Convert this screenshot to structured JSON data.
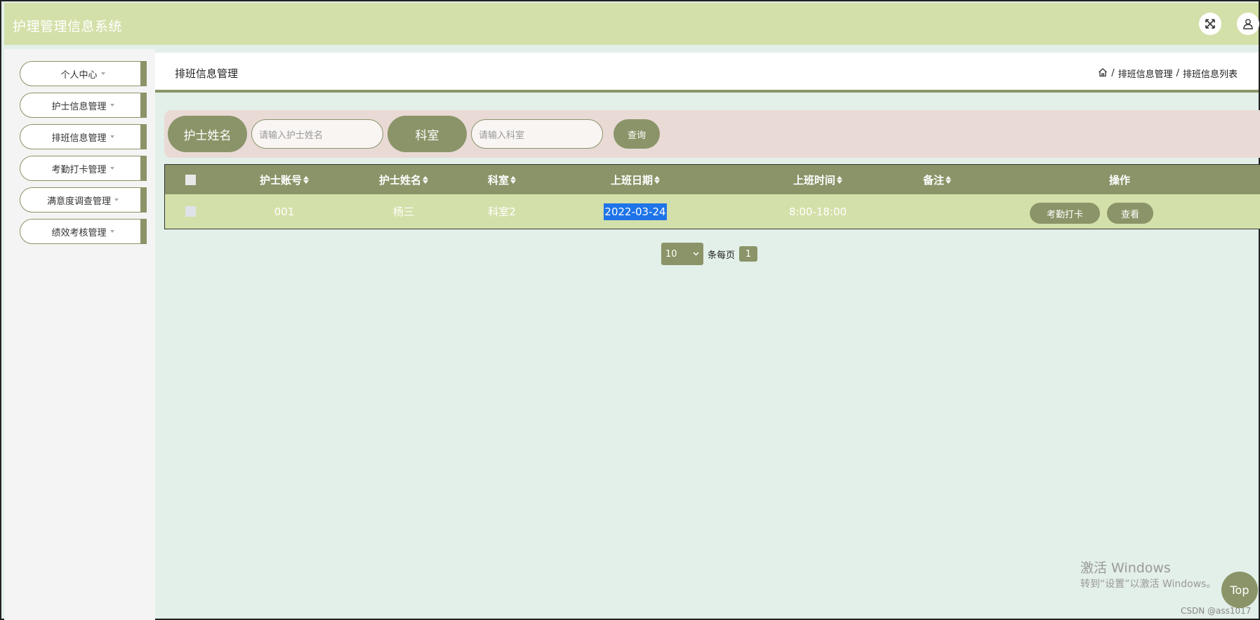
{
  "app": {
    "title": "护理管理信息系统"
  },
  "icons": {
    "expand": "expand-icon",
    "user": "user-icon",
    "home": "home-icon"
  },
  "sidebar": {
    "items": [
      {
        "label": "个人中心"
      },
      {
        "label": "护士信息管理"
      },
      {
        "label": "排班信息管理"
      },
      {
        "label": "考勤打卡管理"
      },
      {
        "label": "满意度调查管理"
      },
      {
        "label": "绩效考核管理"
      }
    ]
  },
  "header": {
    "title": "排班信息管理",
    "breadcrumb": [
      "排班信息管理",
      "排班信息列表"
    ],
    "separator": "/"
  },
  "search": {
    "label1": "护士姓名",
    "placeholder1": "请输入护士姓名",
    "label2": "科室",
    "placeholder2": "请输入科室",
    "button": "查询"
  },
  "table": {
    "columns": [
      "护士账号",
      "护士姓名",
      "科室",
      "上班日期",
      "上班时间",
      "备注",
      "操作"
    ],
    "rows": [
      {
        "account": "001",
        "name": "杨三",
        "dept": "科室2",
        "date": "2022-03-24",
        "time": "8:00-18:00",
        "note": "",
        "actions": [
          "考勤打卡",
          "查看"
        ]
      }
    ]
  },
  "pagination": {
    "page_size": "10",
    "per_page_label": "条每页",
    "current_page": "1"
  },
  "watermark": {
    "line1": "激活 Windows",
    "line2": "转到“设置”以激活 Windows。",
    "credit": "CSDN @ass1017"
  },
  "back_to_top": "Top",
  "colors": {
    "topbar": "#d3e0a9",
    "accent": "#8a9468",
    "background": "#e3efe9",
    "search_bg": "#e9dad6",
    "row_bg": "#d3e0a9",
    "selection": "#1e74e8"
  }
}
